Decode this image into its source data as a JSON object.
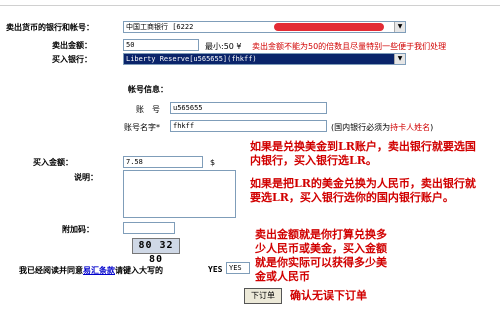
{
  "form": {
    "sell_bank_label": "卖出货币的银行和帐号：",
    "sell_bank_value": "中国工商银行 [6222",
    "sell_amount_label": "卖出金额：",
    "sell_amount_value": "50",
    "min_note": "最小:50 ¥",
    "amount_warning": "卖出金额不能为50的倍数且尽量特别一些便于我们处理",
    "buy_bank_label": "买入银行：",
    "buy_bank_value": "Liberty Reserve[u565655](fhkff)",
    "account_info_title": "帐号信息：",
    "account_label": "账　号",
    "account_value": "u565655",
    "account_name_label": "账号名字*",
    "account_name_value": "fhkff",
    "account_name_note_prefix": "(国内银行必须为",
    "account_name_note_highlight": "持卡人姓名",
    "account_name_note_suffix": ")",
    "buy_amount_label": "买入金额：",
    "buy_amount_value": "7.58",
    "buy_amount_unit": "$",
    "description_label": "说明：",
    "postscript_label": "附加码：",
    "captcha_text": "80 32 80",
    "agree_prefix": "我已经阅读并同意",
    "agree_link": "易汇条款",
    "agree_suffix": "请键入大写的",
    "agree_keyword": "YES",
    "agree_input_value": "YES",
    "submit_label": "下订单"
  },
  "annotations": {
    "note1": "如果是兑换美金到LR账户，卖出银行就要选国内银行，买入银行选LR。",
    "note2": "如果是把LR的美金兑换为人民币，卖出银行就要选LR，买入银行选你的国内银行账户。",
    "note3": "卖出金额就是你打算兑换多少人民币或美金，买入金额就是你实际可以获得多少美金或人民币",
    "note4": "确认无误下订单"
  },
  "colors": {
    "accent_red": "#d10000",
    "select_highlight": "#0a246a",
    "link_blue": "#0000cc"
  },
  "icons": {
    "dropdown": "chevron-down-icon"
  }
}
